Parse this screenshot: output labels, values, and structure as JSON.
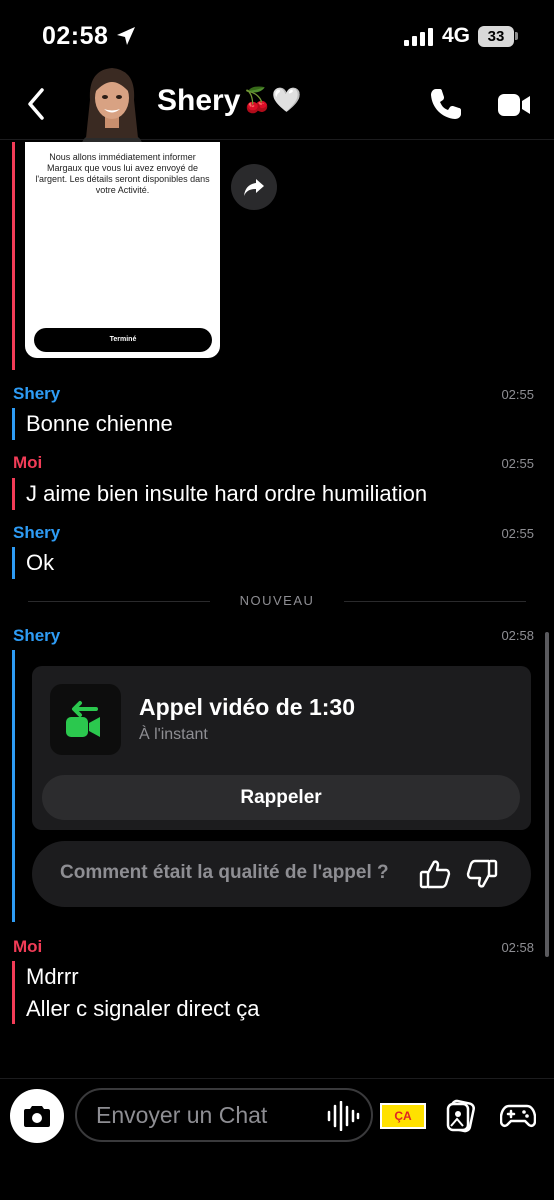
{
  "status": {
    "time": "02:58",
    "network": "4G",
    "battery": "33"
  },
  "header": {
    "name": "Shery",
    "emoji": "🍒🤍"
  },
  "snap": {
    "text": "Nous allons immédiatement informer Margaux que vous lui avez envoyé de l'argent. Les détails seront disponibles dans votre Activité.",
    "button": "Terminé"
  },
  "messages": [
    {
      "sender": "Shery",
      "time": "02:55",
      "text": "Bonne chienne"
    },
    {
      "sender": "Moi",
      "time": "02:55",
      "text": "J aime bien insulte hard ordre humiliation"
    },
    {
      "sender": "Shery",
      "time": "02:55",
      "text": "Ok"
    }
  ],
  "divider": "NOUVEAU",
  "call": {
    "sender": "Shery",
    "time": "02:58",
    "title": "Appel vidéo de 1:30",
    "subtitle": "À l'instant",
    "recall": "Rappeler",
    "rating_question": "Comment était la qualité de l'appel ?"
  },
  "last_message": {
    "sender": "Moi",
    "time": "02:58",
    "line1": "Mdrrr",
    "line2": "Aller c signaler direct ça"
  },
  "input": {
    "placeholder": "Envoyer un Chat"
  },
  "sticker": {
    "label": "ÇA"
  },
  "colors": {
    "them": "#2e9cf5",
    "me": "#f23c57",
    "call_green": "#2bc84e"
  }
}
